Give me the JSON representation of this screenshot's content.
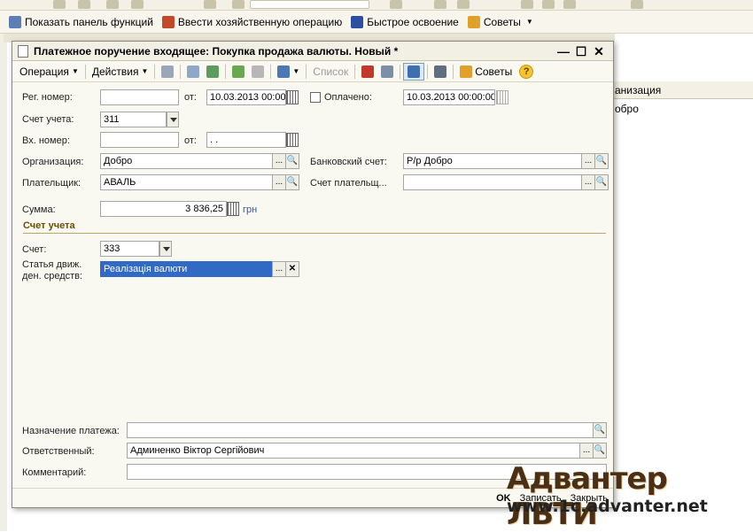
{
  "app_toolbar": {
    "items": [
      {
        "icon": "functions-panel-icon",
        "label": "Показать панель функций"
      },
      {
        "icon": "business-operation-icon",
        "label": "Ввести хозяйственную операцию"
      },
      {
        "icon": "quick-start-icon",
        "label": "Быстрое освоение"
      },
      {
        "icon": "tips-icon",
        "label": "Советы"
      }
    ]
  },
  "background": {
    "column_header_partial": "анизация",
    "cell_partial": "обро"
  },
  "window": {
    "title": "Платежное поручение входящее: Покупка продажа валюты. Новый *",
    "controls": {
      "minimize": "—",
      "maximize": "☐",
      "close": "✕"
    }
  },
  "toolbar": {
    "operation": "Операция",
    "actions": "Действия",
    "list": "Список",
    "tips": "Советы",
    "help": "?"
  },
  "form": {
    "reg_number_label": "Рег. номер:",
    "reg_number_value": "",
    "from_label": "от:",
    "reg_date": "10.03.2013 00:00",
    "paid_label": "Оплачено:",
    "paid_date": "10.03.2013 00:00:00",
    "account_label": "Счет учета:",
    "account_value": "311",
    "incoming_number_label": "Вх. номер:",
    "incoming_number_value": "",
    "from2_label": "от:",
    "incoming_date": " . . ",
    "organization_label": "Организация:",
    "organization_value": "Добро",
    "bank_account_label": "Банковский счет:",
    "bank_account_value": "Р/р Добро",
    "payer_label": "Плательщик:",
    "payer_value": "АВАЛЬ",
    "payer_account_label": "Счет плательщ...",
    "payer_account_value": "",
    "sum_label": "Сумма:",
    "sum_value": "3 836,25",
    "currency": "грн",
    "section_title": "Счет учета",
    "acc_label": "Счет:",
    "acc_value": "333",
    "cash_flow_label_1": "Статья движ.",
    "cash_flow_label_2": "ден. средств:",
    "cash_flow_value": "Реалізація валюти",
    "purpose_label": "Назначение платежа:",
    "purpose_value": "",
    "responsible_label": "Ответственный:",
    "responsible_value": "Админенко Віктор Сергійович",
    "comment_label": "Комментарий:",
    "comment_value": ""
  },
  "bottom": {
    "ok": "OK",
    "save": "Записать",
    "close": "Закрыть"
  },
  "watermark": {
    "brand": "Адвантер ЛВТИ",
    "url": "www.1c.advanter.net"
  }
}
